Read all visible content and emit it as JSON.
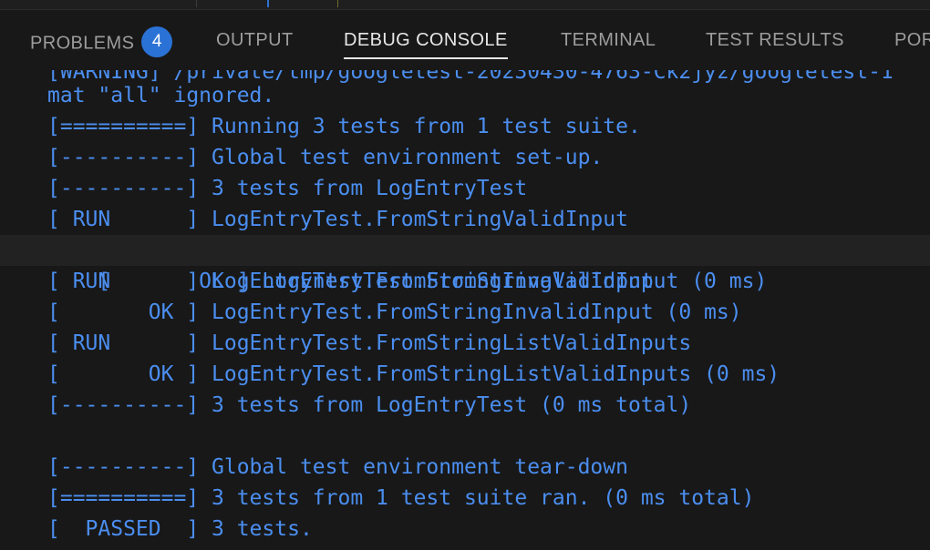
{
  "panel": {
    "tabs": [
      {
        "label": "PROBLEMS",
        "badge": "4",
        "active": false
      },
      {
        "label": "OUTPUT",
        "active": false
      },
      {
        "label": "DEBUG CONSOLE",
        "active": true
      },
      {
        "label": "TERMINAL",
        "active": false
      },
      {
        "label": "TEST RESULTS",
        "active": false
      },
      {
        "label": "POR",
        "active": false
      }
    ]
  },
  "console": {
    "lines": [
      "[WARNING] /private/tmp/googletest-20230430-4763-Ck2jyz/googletest-1",
      "mat \"all\" ignored.",
      "[==========] Running 3 tests from 1 test suite.",
      "[----------] Global test environment set-up.",
      "[----------] 3 tests from LogEntryTest",
      "[ RUN      ] LogEntryTest.FromStringValidInput",
      "[       OK ] LogEntryTest.FromStringValidInput (0 ms)",
      "[ RUN      ] LogEntryTest.FromStringInvalidInput",
      "[       OK ] LogEntryTest.FromStringInvalidInput (0 ms)",
      "[ RUN      ] LogEntryTest.FromStringListValidInputs",
      "[       OK ] LogEntryTest.FromStringListValidInputs (0 ms)",
      "[----------] 3 tests from LogEntryTest (0 ms total)",
      "",
      "[----------] Global test environment tear-down",
      "[==========] 3 tests from 1 test suite ran. (0 ms total)",
      "[  PASSED  ] 3 tests."
    ],
    "highlighted_line_index": 6,
    "text_color": "#4b8ef0"
  },
  "colors": {
    "background": "#181818",
    "tab_inactive": "#9d9d9d",
    "tab_active": "#e7e7e7",
    "badge": "#2b72d6",
    "highlight_row": "#222222"
  }
}
